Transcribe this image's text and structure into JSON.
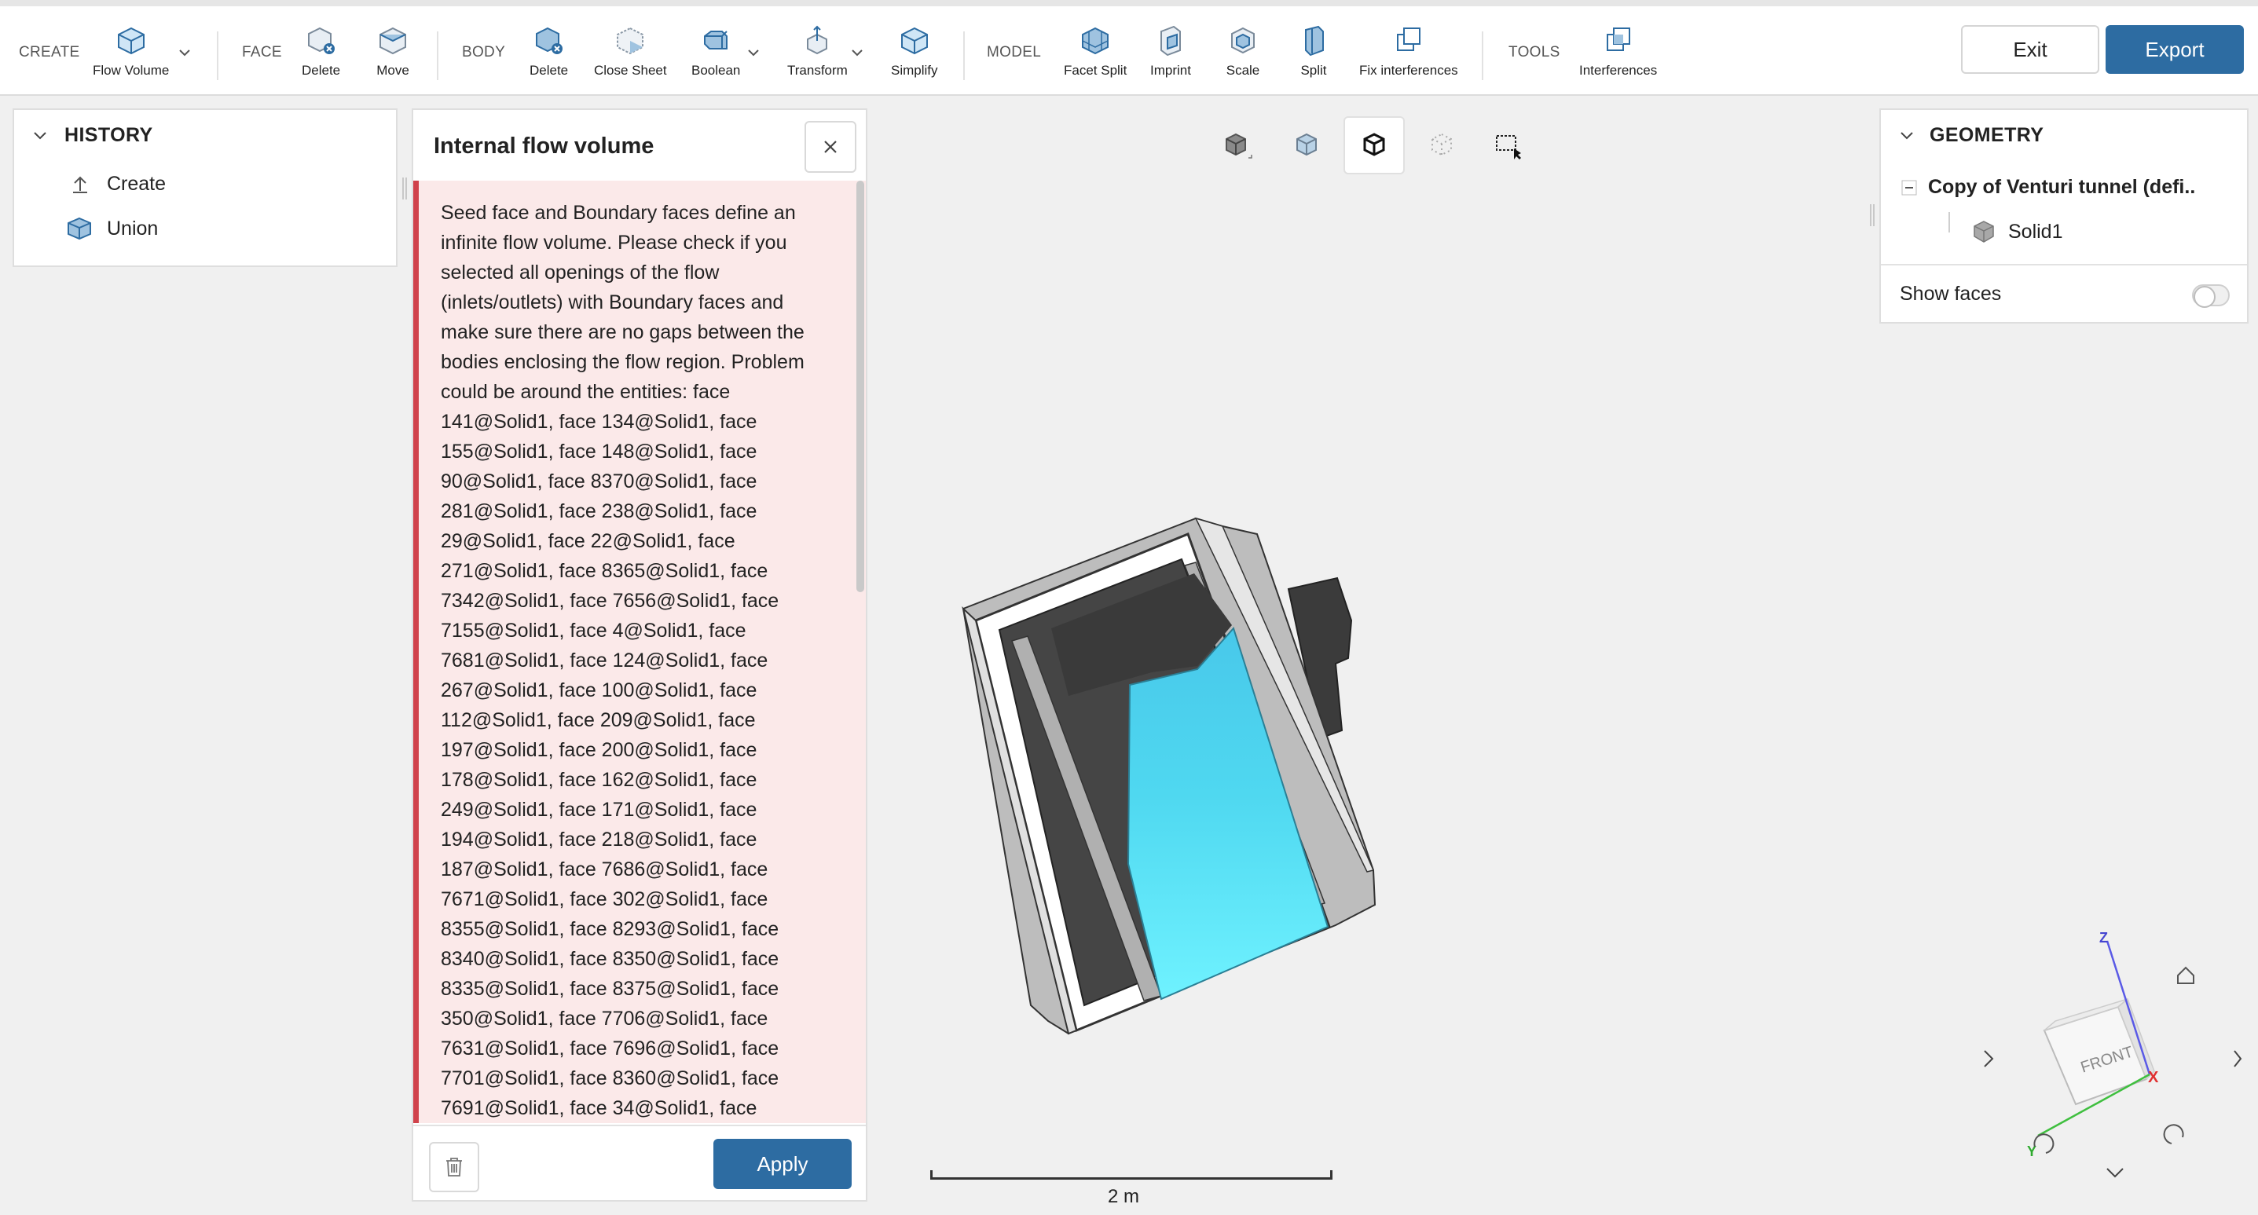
{
  "toolbar": {
    "groups": {
      "create": "CREATE",
      "face": "FACE",
      "body": "BODY",
      "model": "MODEL",
      "tools": "TOOLS"
    },
    "tools": {
      "flow_volume": "Flow Volume",
      "face_delete": "Delete",
      "face_move": "Move",
      "body_delete": "Delete",
      "close_sheet": "Close Sheet",
      "boolean": "Boolean",
      "transform": "Transform",
      "simplify": "Simplify",
      "facet_split": "Facet Split",
      "imprint": "Imprint",
      "scale": "Scale",
      "split": "Split",
      "fix_interferences": "Fix interferences",
      "interferences": "Interferences"
    },
    "exit": "Exit",
    "export": "Export"
  },
  "history": {
    "title": "HISTORY",
    "items": [
      {
        "label": "Create",
        "icon": "upload-arrow-icon"
      },
      {
        "label": "Union",
        "icon": "cube-icon"
      }
    ]
  },
  "dialog": {
    "title": "Internal flow volume",
    "error": "Seed face and Boundary faces define an infinite flow volume. Please check if you selected all openings of the flow (inlets/outlets) with Boundary faces and make sure there are no gaps between the bodies enclosing the flow region. Problem could be around the entities: face 141@Solid1, face 134@Solid1, face 155@Solid1, face 148@Solid1, face 90@Solid1, face 8370@Solid1, face 281@Solid1, face 238@Solid1, face 29@Solid1, face 22@Solid1, face 271@Solid1, face 8365@Solid1, face 7342@Solid1, face 7656@Solid1, face 7155@Solid1, face 4@Solid1, face 7681@Solid1, face 124@Solid1, face 267@Solid1, face 100@Solid1, face 112@Solid1, face 209@Solid1, face 197@Solid1, face 200@Solid1, face 178@Solid1, face 162@Solid1, face 249@Solid1, face 171@Solid1, face 194@Solid1, face 218@Solid1, face 187@Solid1, face 7686@Solid1, face 7671@Solid1, face 302@Solid1, face 8355@Solid1, face 8293@Solid1, face 8340@Solid1, face 8350@Solid1, face 8335@Solid1, face 8375@Solid1, face 350@Solid1, face 7706@Solid1, face 7631@Solid1, face 7696@Solid1, face 7701@Solid1, face 8360@Solid1, face 7691@Solid1, face 34@Solid1, face",
    "apply": "Apply"
  },
  "geometry": {
    "title": "GEOMETRY",
    "root": "Copy of Venturi tunnel (defi..",
    "child": "Solid1",
    "show_faces": "Show faces",
    "show_faces_on": false
  },
  "viewport": {
    "scale_label": "2 m",
    "cube_face": "FRONT",
    "axes": {
      "x": "X",
      "y": "Y",
      "z": "Z"
    }
  },
  "colors": {
    "accent": "#2d6ca2",
    "error_bg": "#fbe9e9",
    "error_border": "#d0424b",
    "flow": "#4fd8f0"
  }
}
